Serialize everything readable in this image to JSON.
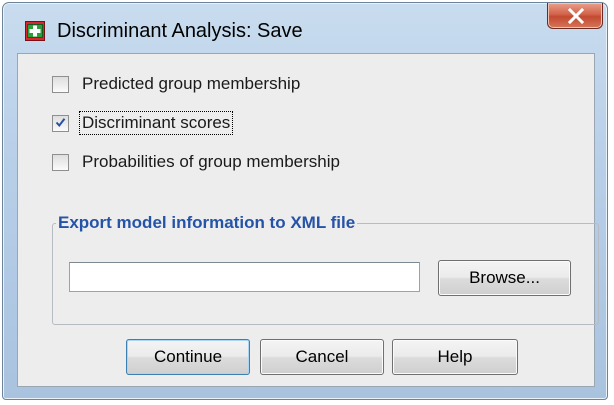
{
  "window": {
    "title": "Discriminant Analysis: Save",
    "close_label": "X"
  },
  "options": [
    {
      "label": "Predicted group membership",
      "checked": false
    },
    {
      "label": "Discriminant scores",
      "checked": true
    },
    {
      "label": "Probabilities of group membership",
      "checked": false
    }
  ],
  "export_group": {
    "title": "Export model information to XML file",
    "file_value": "",
    "browse_label": "Browse..."
  },
  "buttons": {
    "continue": "Continue",
    "cancel": "Cancel",
    "help": "Help"
  },
  "icons": {
    "app": "spss-dialog-icon",
    "close": "close-icon",
    "checkmark": "checkmark-icon"
  },
  "colors": {
    "group_title": "#2553a7",
    "close_button": "#c24a30",
    "title_bar": "#b8cfe8"
  }
}
